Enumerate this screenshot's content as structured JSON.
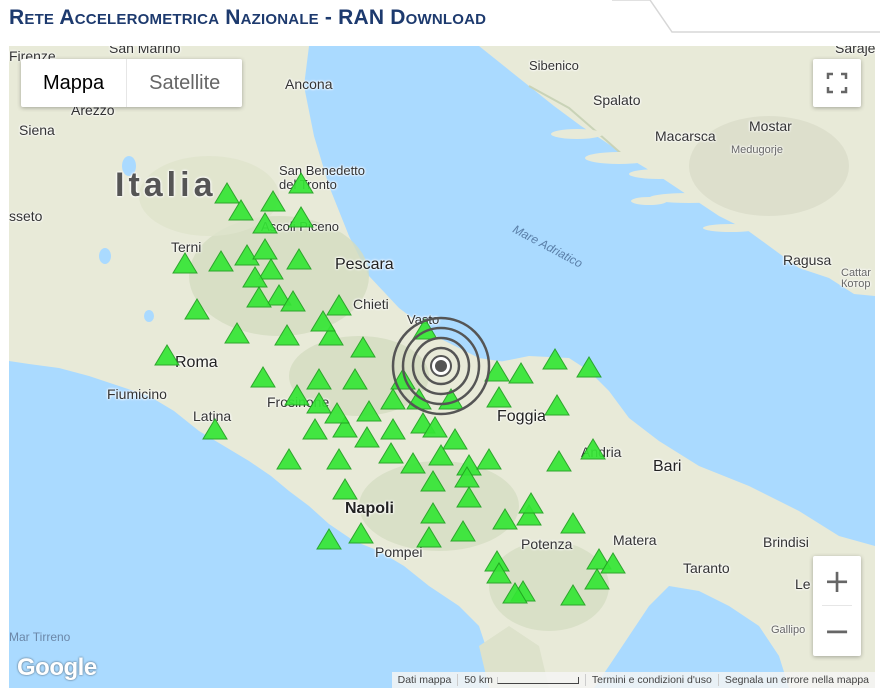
{
  "header": {
    "title": "Rete Accelerometrica Nazionale - RAN Download"
  },
  "map": {
    "map_type_buttons": [
      {
        "label": "Mappa",
        "active": true
      },
      {
        "label": "Satellite",
        "active": false
      }
    ],
    "country_label": "Italia",
    "sea_labels": {
      "adriatic": "Mare Adriatico",
      "tirreno": "Mar Tirreno"
    },
    "city_labels": {
      "san_marino": "San Marino",
      "firenze": "Firenze",
      "arezzo": "Arezzo",
      "siena": "Siena",
      "grosseto": "sseto",
      "ancona": "Ancona",
      "san_benedetto": "San Benedetto\ndel Tronto",
      "ascoli": "Ascoli Piceno",
      "terni": "Terni",
      "pescara": "Pescara",
      "chieti": "Chieti",
      "vasto": "Vasto",
      "roma": "Roma",
      "fiumicino": "Fiumicino",
      "latina": "Latina",
      "frosinone": "Frosinone",
      "foggia": "Foggia",
      "andria": "Andria",
      "bari": "Bari",
      "napoli": "Napoli",
      "pompei": "Pompei",
      "potenza": "Potenza",
      "matera": "Matera",
      "taranto": "Taranto",
      "brindisi": "Brindisi",
      "lecce": "Le",
      "gallipoli": "Gallipo",
      "sibenico": "Sibenico",
      "spalato": "Spalato",
      "macarsca": "Macarsca",
      "mostar": "Mostar",
      "medugorje": "Medugorje",
      "ragusa": "Ragusa",
      "cattaro": "Cattar\nКотор",
      "sarajevo": "Saraje"
    },
    "stations_count": 80,
    "epicenter": {
      "rings": 4
    },
    "controls": {
      "zoom_in": "+",
      "zoom_out": "−",
      "fullscreen_icon": "fullscreen-icon"
    },
    "logo": "Google",
    "attribution": {
      "map_data": "Dati mappa",
      "scale": "50 km",
      "terms": "Termini e condizioni d'uso",
      "report": "Segnala un errore nella mappa"
    },
    "colors": {
      "sea": "#aadaff",
      "land": "#e8ead8",
      "station": "#35e635",
      "epicenter": "#555555"
    }
  }
}
